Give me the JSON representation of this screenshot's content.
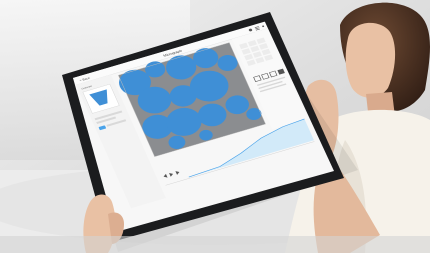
{
  "app": {
    "title": "Micrograph",
    "back_label": "< Back"
  },
  "left_panel": {
    "section_label": "Overview"
  },
  "toolbar": {
    "menu_icon": "hamburger-icon",
    "dots_icon": "more-icon"
  },
  "colors": {
    "background": "#e9e9e9",
    "tablet_bezel": "#1b1c1e",
    "screen": "#f7f7f7",
    "image_gray": "#8b8d90",
    "blob_blue": "#3f8fd6",
    "accent": "#4aa3ea",
    "skin": "#e8c3a8",
    "shirt": "#f6f2ea"
  }
}
